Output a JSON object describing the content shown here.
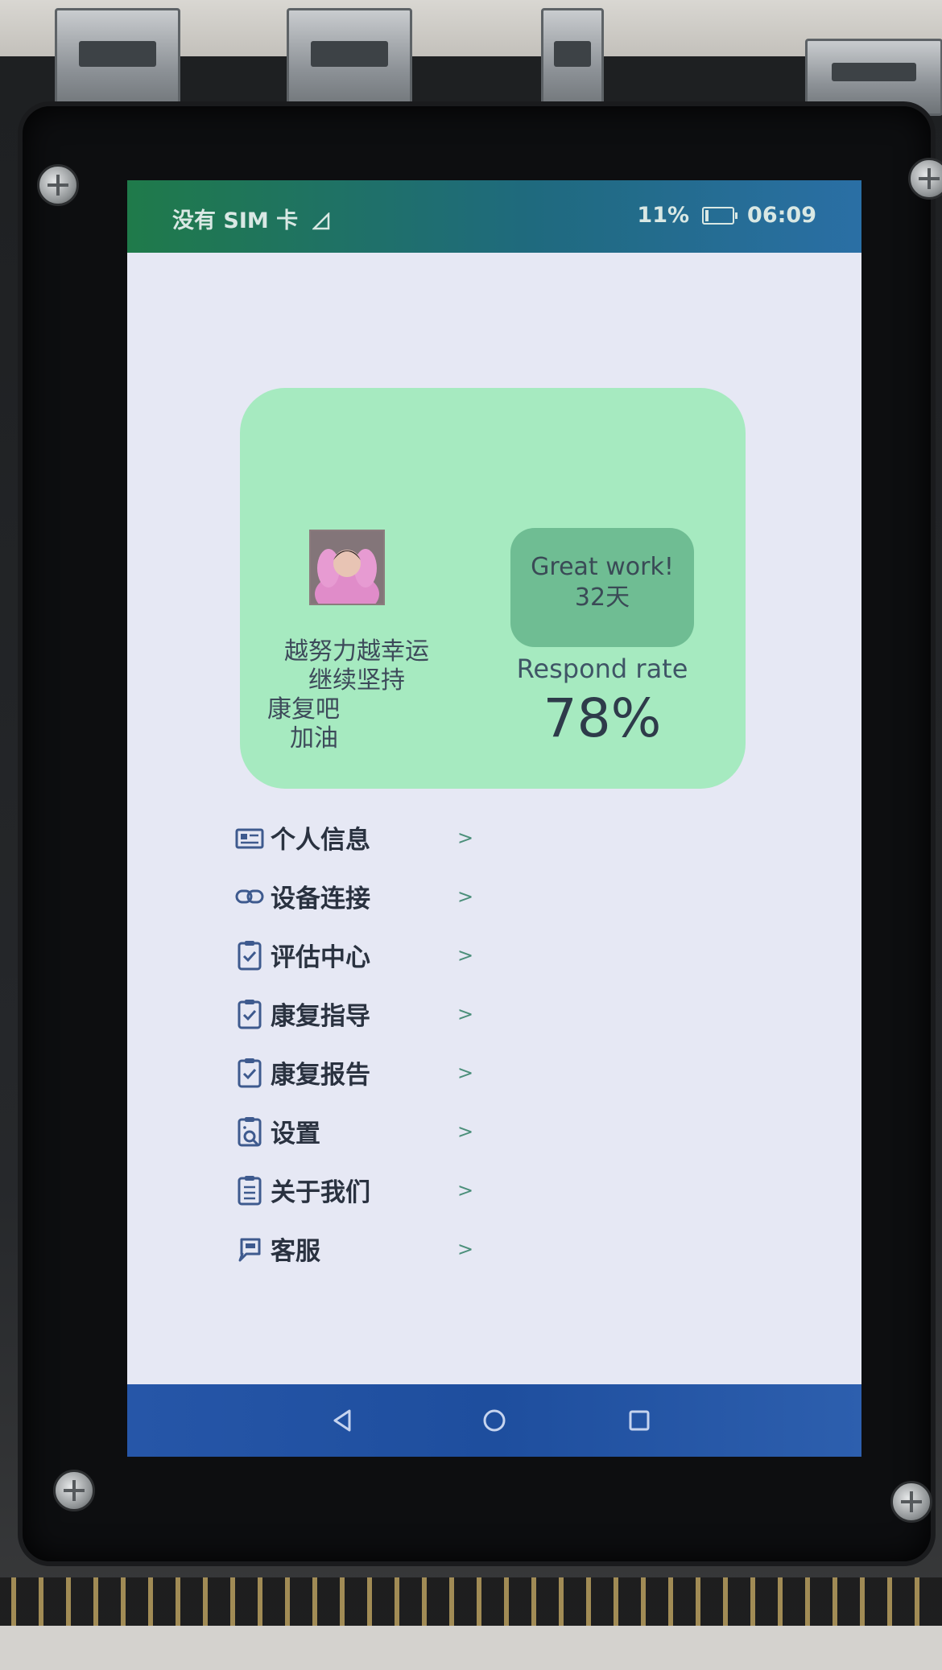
{
  "status_bar": {
    "carrier": "没有 SIM 卡",
    "battery": "11%",
    "time": "06:09"
  },
  "card": {
    "avatar": "avatar",
    "motto": [
      "越努力越幸运",
      "继续坚持",
      "康复吧",
      "加油"
    ],
    "badge_line1": "Great work!",
    "badge_line2": "32天",
    "respond_label": "Respond rate",
    "respond_value": "78%",
    "respond_rate_percent": 78,
    "colors": {
      "card": "#a6eac0",
      "badge": "#6fbd93"
    }
  },
  "menu": [
    {
      "label": "个人信息",
      "icon": "id-card-icon",
      "arrow": ">"
    },
    {
      "label": "设备连接",
      "icon": "link-icon",
      "arrow": ">"
    },
    {
      "label": "评估中心",
      "icon": "clipboard-check-icon",
      "arrow": ">"
    },
    {
      "label": "康复指导",
      "icon": "clipboard-check-icon",
      "arrow": ">"
    },
    {
      "label": "康复报告",
      "icon": "clipboard-check-icon",
      "arrow": ">"
    },
    {
      "label": "设置",
      "icon": "clipboard-search-icon",
      "arrow": ">"
    },
    {
      "label": "关于我们",
      "icon": "clipboard-list-icon",
      "arrow": ">"
    },
    {
      "label": "客服",
      "icon": "chat-icon",
      "arrow": ">"
    }
  ],
  "nav_bar": {
    "back": "back-icon",
    "home": "home-icon",
    "recents": "recents-icon"
  }
}
